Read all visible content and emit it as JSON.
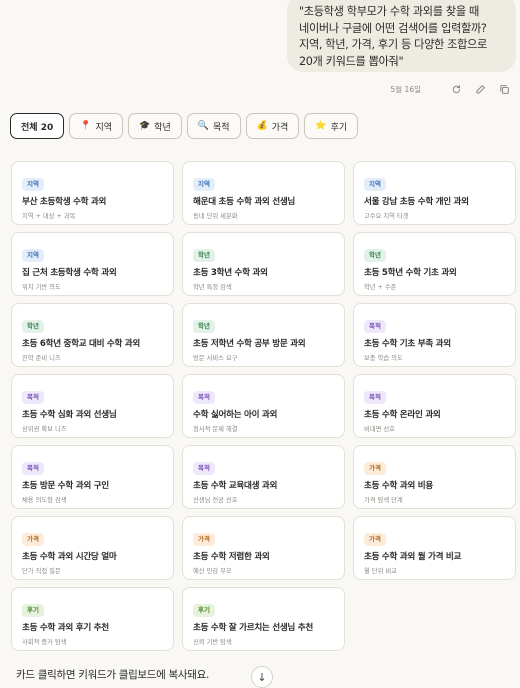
{
  "message": {
    "text": "\"초등학생 학부모가 수학 과외를 찾을 때\n네이버나 구글에 어떤 검색어를 입력할까?\n지역, 학년, 가격, 후기 등 다양한 조합으로\n20개 키워드를 뽑아줘\"",
    "date": "5월 16일"
  },
  "meta_icons": [
    "retry-icon",
    "edit-icon",
    "copy-icon"
  ],
  "filters": [
    {
      "label": "전체 20",
      "icon": "",
      "active": true
    },
    {
      "label": "지역",
      "icon": "📍",
      "active": false
    },
    {
      "label": "학년",
      "icon": "🎓",
      "active": false
    },
    {
      "label": "목적",
      "icon": "🔍",
      "active": false
    },
    {
      "label": "가격",
      "icon": "💰",
      "active": false
    },
    {
      "label": "후기",
      "icon": "⭐",
      "active": false
    }
  ],
  "cards": [
    {
      "tag": "지역",
      "type": "region",
      "keyword": "부산 초등학생 수학 과외",
      "note": "지역 + 대상 + 과목"
    },
    {
      "tag": "지역",
      "type": "region",
      "keyword": "해운대 초등 수학 과외 선생님",
      "note": "동네 단위 세분화"
    },
    {
      "tag": "지역",
      "type": "region",
      "keyword": "서울 강남 초등 수학 개인 과외",
      "note": "고수요 지역 타겟"
    },
    {
      "tag": "지역",
      "type": "region",
      "keyword": "집 근처 초등학생 수학 과외",
      "note": "위치 기반 의도"
    },
    {
      "tag": "학년",
      "type": "grade",
      "keyword": "초등 3학년 수학 과외",
      "note": "학년 특정 검색"
    },
    {
      "tag": "학년",
      "type": "grade",
      "keyword": "초등 5학년 수학 기초 과외",
      "note": "학년 + 수준"
    },
    {
      "tag": "학년",
      "type": "grade",
      "keyword": "초등 6학년 중학교 대비 수학 과외",
      "note": "진학 준비 니즈"
    },
    {
      "tag": "학년",
      "type": "grade",
      "keyword": "초등 저학년 수학 공부 방문 과외",
      "note": "방문 서비스 요구"
    },
    {
      "tag": "목적",
      "type": "purpose",
      "keyword": "초등 수학 기초 부족 과외",
      "note": "보충 학습 의도"
    },
    {
      "tag": "목적",
      "type": "purpose",
      "keyword": "초등 수학 심화 과외 선생님",
      "note": "상위권 확보 니즈"
    },
    {
      "tag": "목적",
      "type": "purpose",
      "keyword": "수학 싫어하는 아이 과외",
      "note": "정서적 문제 해결"
    },
    {
      "tag": "목적",
      "type": "purpose",
      "keyword": "초등 수학 온라인 과외",
      "note": "비대면 선호"
    },
    {
      "tag": "목적",
      "type": "purpose",
      "keyword": "초등 방문 수학 과외 구인",
      "note": "채용 의도형 검색"
    },
    {
      "tag": "목적",
      "type": "purpose",
      "keyword": "초등 수학 교육대생 과외",
      "note": "선생님 전공 선호"
    },
    {
      "tag": "가격",
      "type": "price",
      "keyword": "초등 수학 과외 비용",
      "note": "가격 탐색 단계"
    },
    {
      "tag": "가격",
      "type": "price",
      "keyword": "초등 수학 과외 시간당 얼마",
      "note": "단가 직접 질문"
    },
    {
      "tag": "가격",
      "type": "price",
      "keyword": "초등 수학 저렴한 과외",
      "note": "예산 민감 부모"
    },
    {
      "tag": "가격",
      "type": "price",
      "keyword": "초등 수학 과외 월 가격 비교",
      "note": "월 단위 비교"
    },
    {
      "tag": "후기",
      "type": "review",
      "keyword": "초등 수학 과외 후기 추천",
      "note": "사회적 증거 탐색"
    },
    {
      "tag": "후기",
      "type": "review",
      "keyword": "초등 수학 잘 가르치는 선생님 추천",
      "note": "신뢰 기반 탐색"
    }
  ],
  "footer": {
    "text": "카드 클릭하면 키워드가 클립보드에 복사돼요.",
    "scroll_icon": "↓"
  }
}
